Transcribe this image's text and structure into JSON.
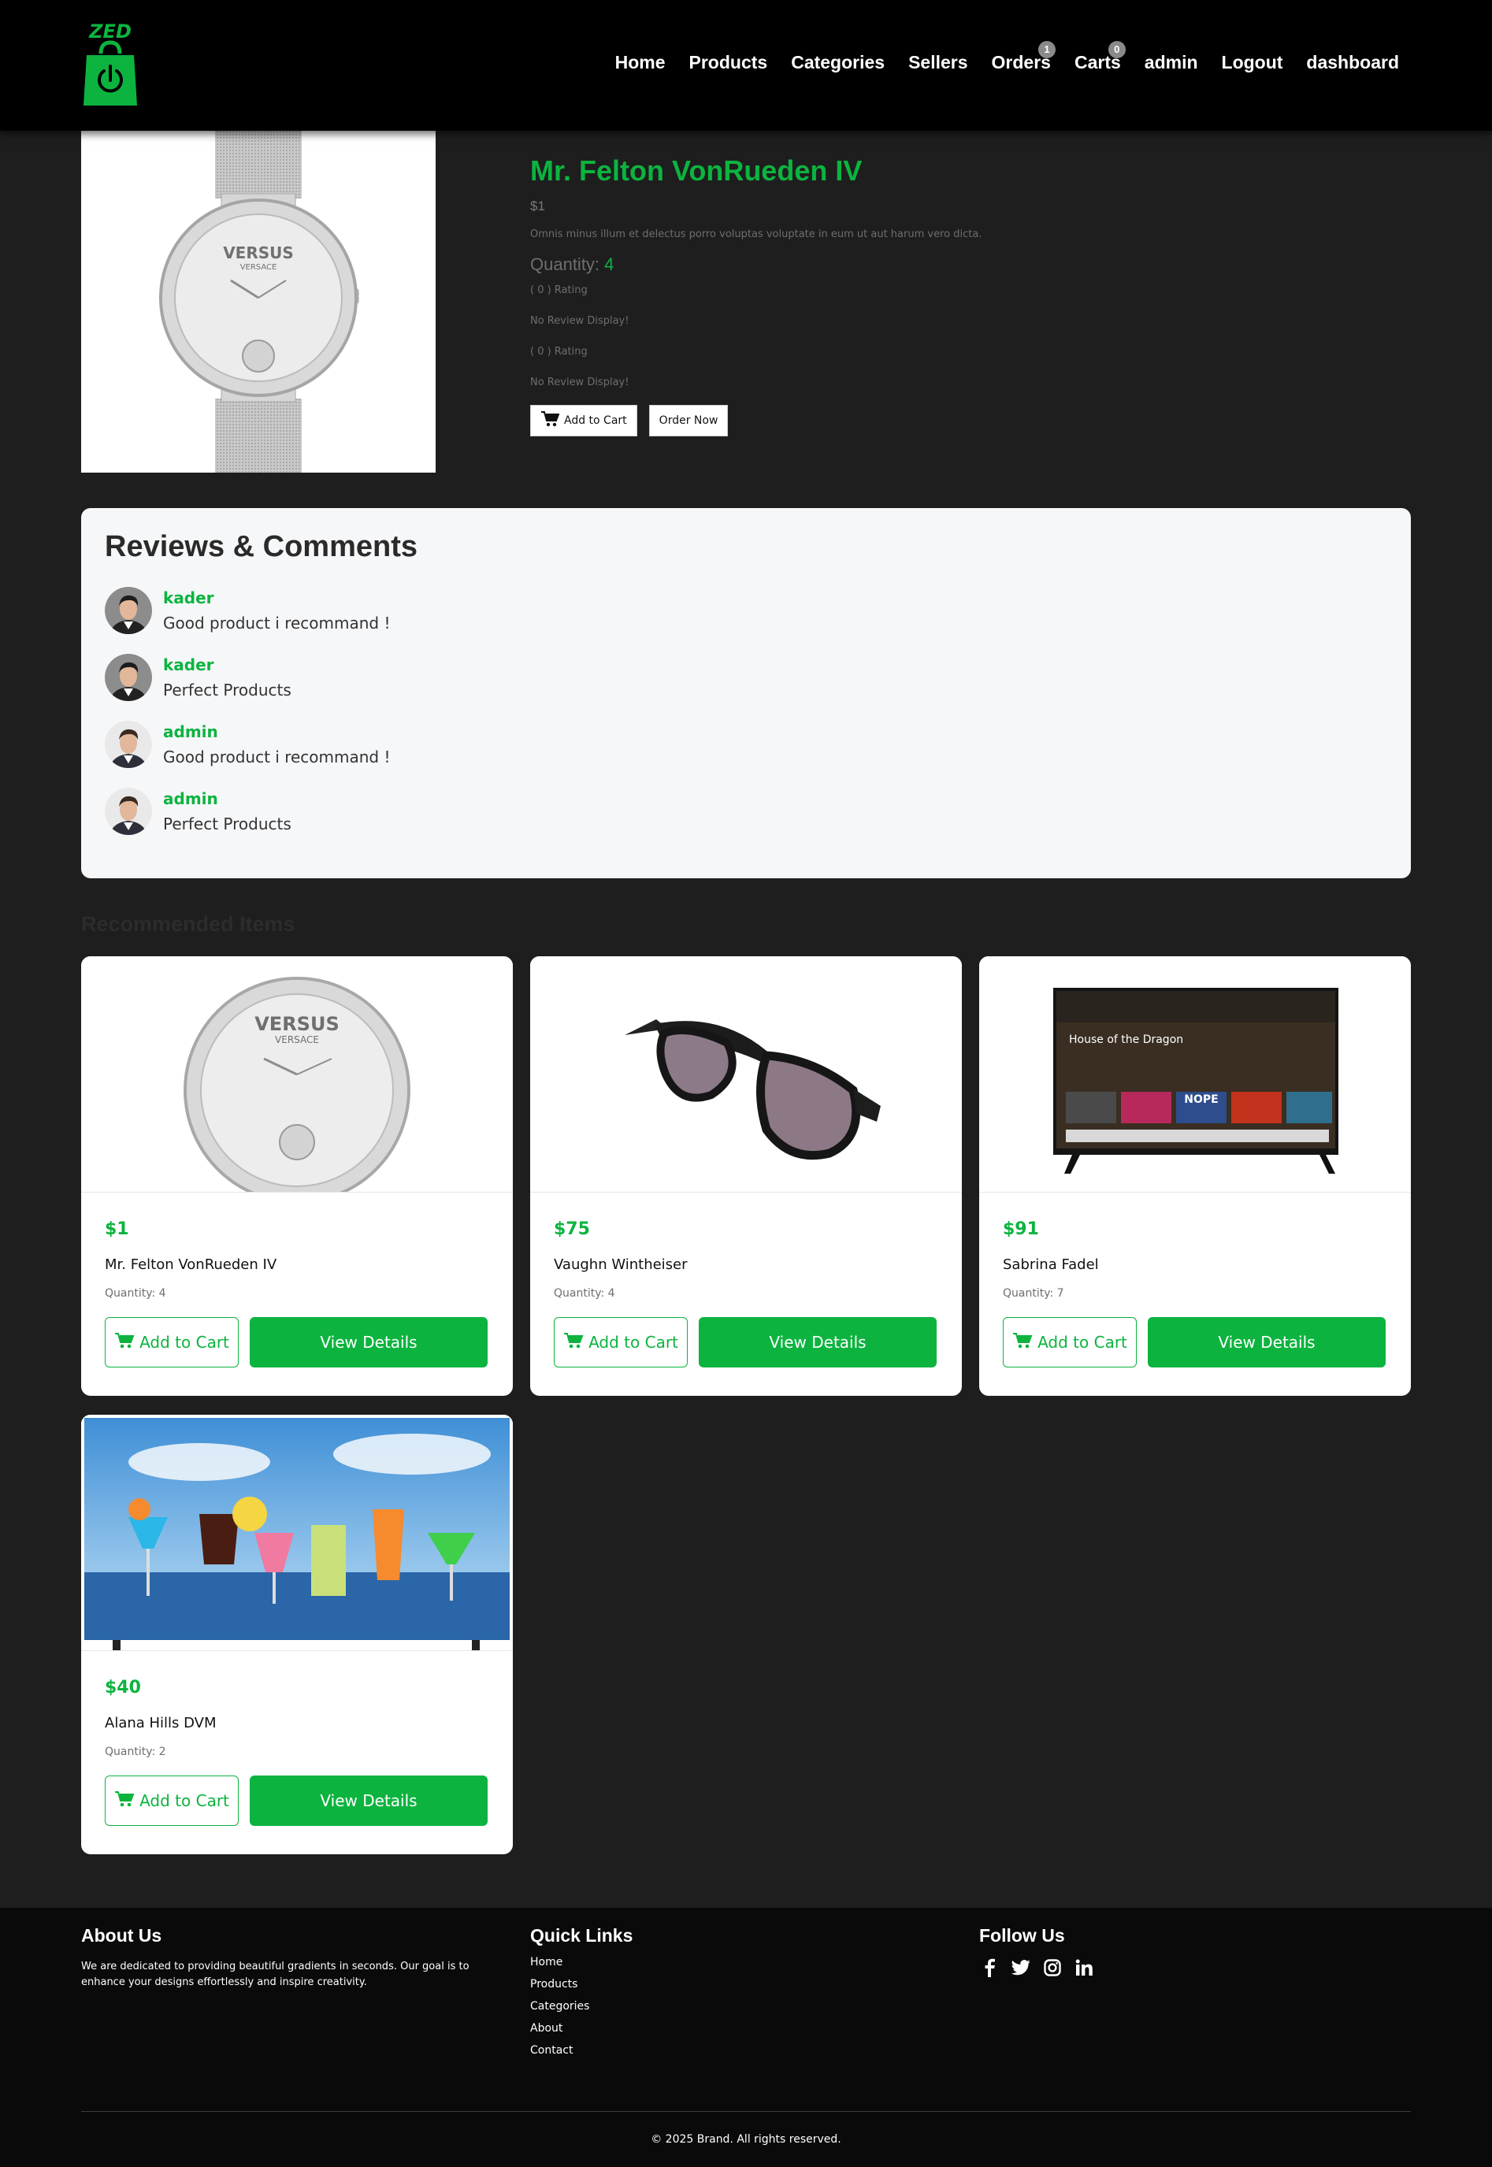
{
  "header": {
    "brand": "ZED",
    "nav": [
      {
        "label": "Home",
        "name": "nav-home"
      },
      {
        "label": "Products",
        "name": "nav-products"
      },
      {
        "label": "Categories",
        "name": "nav-categories"
      },
      {
        "label": "Sellers",
        "name": "nav-sellers"
      },
      {
        "label": "Orders",
        "name": "nav-orders",
        "badge": "1"
      },
      {
        "label": "Carts",
        "name": "nav-carts",
        "badge": "0"
      },
      {
        "label": "admin",
        "name": "nav-admin"
      },
      {
        "label": "Logout",
        "name": "nav-logout"
      },
      {
        "label": "dashboard",
        "name": "nav-dashboard"
      }
    ]
  },
  "product": {
    "title": "Mr. Felton VonRueden IV",
    "price": "$1",
    "description": "Omnis minus illum et delectus porro voluptas voluptate in eum ut aut harum vero dicta.",
    "quantity_label": "Quantity: ",
    "quantity_value": "4",
    "rating_1": "( 0 ) Rating",
    "no_review_1": "No Review Display!",
    "rating_2": "( 0 ) Rating",
    "no_review_2": "No Review Display!",
    "add_to_cart": "Add to Cart",
    "order_now": "Order Now"
  },
  "reviews": {
    "title": "Reviews & Comments",
    "items": [
      {
        "user": "kader",
        "text": "Good product i recommand !"
      },
      {
        "user": "kader",
        "text": "Perfect Products"
      },
      {
        "user": "admin",
        "text": "Good product i recommand !"
      },
      {
        "user": "admin",
        "text": "Perfect Products"
      }
    ]
  },
  "recommended": {
    "title": "Recommended Items",
    "add_to_cart": "Add to Cart",
    "view_details": "View Details",
    "items": [
      {
        "price": "$1",
        "name": "Mr. Felton VonRueden IV",
        "quantity": "Quantity: 4"
      },
      {
        "price": "$75",
        "name": "Vaughn Wintheiser",
        "quantity": "Quantity: 4"
      },
      {
        "price": "$91",
        "name": "Sabrina Fadel",
        "quantity": "Quantity: 7"
      },
      {
        "price": "$40",
        "name": "Alana Hills DVM",
        "quantity": "Quantity: 2"
      }
    ]
  },
  "watch_brand": {
    "line1": "VERSUS",
    "line2": "VERSACE"
  },
  "tv_screen": {
    "title": "House of the Dragon",
    "tile": "NOPE"
  },
  "footer": {
    "about_title": "About Us",
    "about_text": "We are dedicated to providing beautiful gradients in seconds. Our goal is to enhance your designs effortlessly and inspire creativity.",
    "links_title": "Quick Links",
    "links": [
      "Home",
      "Products",
      "Categories",
      "About",
      "Contact"
    ],
    "follow_title": "Follow Us",
    "social_icons": [
      "facebook-icon",
      "twitter-icon",
      "instagram-icon",
      "linkedin-icon"
    ],
    "copyright": "© 2025 Brand. All rights reserved."
  },
  "colors": {
    "accent": "#0cb43f",
    "background": "#1e1e1f",
    "navbar": "#000000",
    "footer": "#0a0a0a"
  }
}
